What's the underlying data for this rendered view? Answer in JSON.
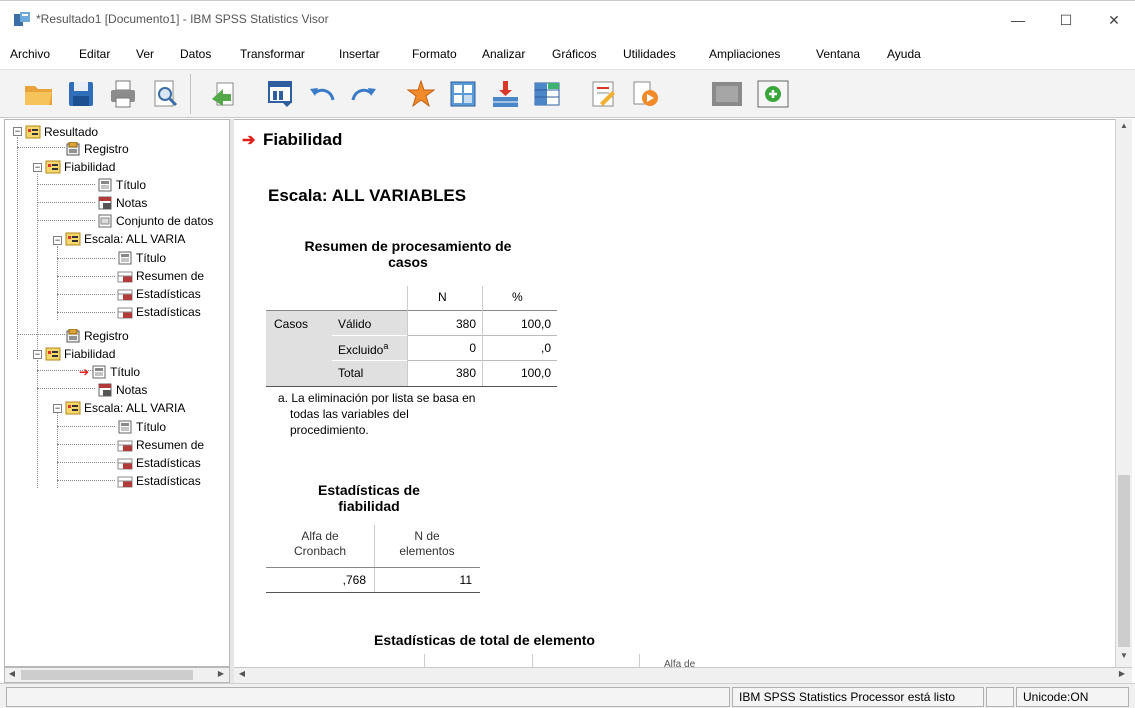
{
  "window": {
    "title": "*Resultado1 [Documento1] - IBM SPSS Statistics Visor",
    "minimize": "—",
    "maximize": "☐",
    "close": "✕"
  },
  "menu": [
    "Archivo",
    "Editar",
    "Ver",
    "Datos",
    "Transformar",
    "Insertar",
    "Formato",
    "Analizar",
    "Gráficos",
    "Utilidades",
    "Ampliaciones",
    "Ventana",
    "Ayuda"
  ],
  "toolbar": {
    "icons": [
      "open-icon",
      "save-icon",
      "print-icon",
      "print-preview-icon",
      "export-icon",
      "goto-data-icon",
      "undo-icon",
      "redo-icon",
      "goto-case-icon",
      "goto-variable-icon",
      "insert-cases-icon",
      "split-icon",
      "designate-window-icon",
      "run-script-icon",
      "collapse-icon",
      "expand-icon"
    ]
  },
  "outline": {
    "nodes": [
      {
        "label": "Resultado",
        "type": "root"
      },
      {
        "label": "Registro",
        "type": "log"
      },
      {
        "label": "Fiabilidad",
        "type": "group"
      },
      {
        "label": "Título",
        "type": "title"
      },
      {
        "label": "Notas",
        "type": "notes"
      },
      {
        "label": "Conjunto de datos",
        "type": "dataset"
      },
      {
        "label": "Escala: ALL VARIA",
        "type": "group"
      },
      {
        "label": "Título",
        "type": "title"
      },
      {
        "label": "Resumen de",
        "type": "table"
      },
      {
        "label": "Estadísticas ",
        "type": "table"
      },
      {
        "label": "Estadísticas ",
        "type": "table"
      },
      {
        "label": "Registro",
        "type": "log"
      },
      {
        "label": "Fiabilidad",
        "type": "group"
      },
      {
        "label": "Título",
        "type": "title"
      },
      {
        "label": "Notas",
        "type": "notes"
      },
      {
        "label": "Escala: ALL VARIA",
        "type": "group"
      },
      {
        "label": "Título",
        "type": "title"
      },
      {
        "label": "Resumen de",
        "type": "table"
      },
      {
        "label": "Estadísticas ",
        "type": "table"
      },
      {
        "label": "Estadísticas ",
        "type": "table"
      }
    ]
  },
  "content": {
    "procedure_title": "Fiabilidad",
    "scale_title": "Escala: ALL VARIABLES",
    "case_summary": {
      "title_line1": "Resumen de procesamiento de",
      "title_line2": "casos",
      "col_n": "N",
      "col_pct": "%",
      "group_label": "Casos",
      "rows": [
        {
          "label": "Válido",
          "sup": "",
          "n": "380",
          "pct": "100,0"
        },
        {
          "label": "Excluido",
          "sup": "a",
          "n": "0",
          "pct": ",0"
        },
        {
          "label": "Total",
          "sup": "",
          "n": "380",
          "pct": "100,0"
        }
      ],
      "footnote_line1": "a. La eliminación por lista se basa en",
      "footnote_line2": "todas las variables del",
      "footnote_line3": "procedimiento."
    },
    "reliability": {
      "title_line1": "Estadísticas de",
      "title_line2": "fiabilidad",
      "col1_line1": "Alfa de",
      "col1_line2": "Cronbach",
      "col2_line1": "N de",
      "col2_line2": "elementos",
      "alpha": ",768",
      "n_items": "11"
    },
    "item_total_title": "Estadísticas de total de elemento",
    "item_total_partial_header": "Alfa de"
  },
  "status": {
    "processor": "IBM SPSS Statistics Processor está listo",
    "unicode": "Unicode:ON"
  }
}
